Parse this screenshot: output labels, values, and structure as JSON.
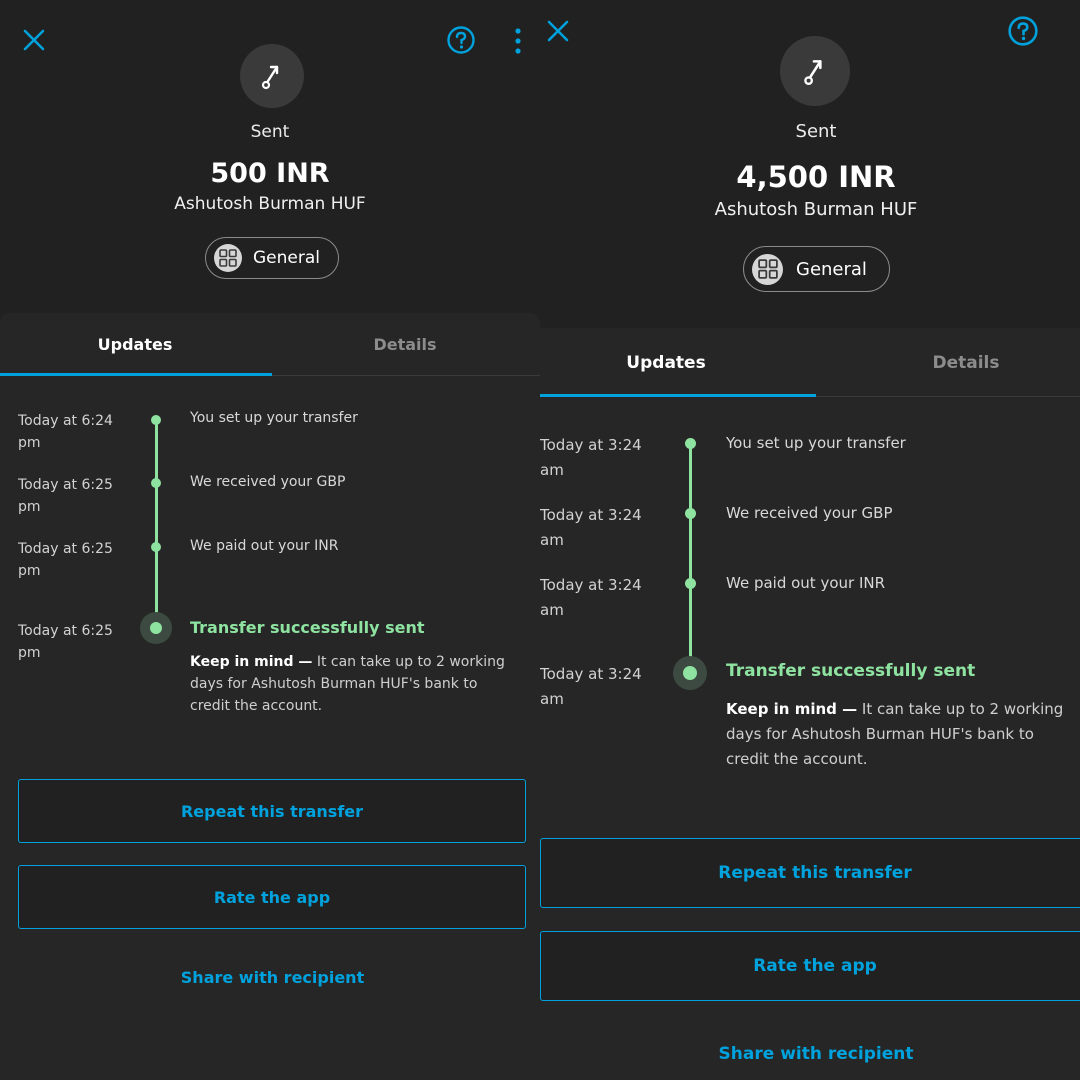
{
  "colors": {
    "background": "#212121",
    "panel": "#262626",
    "accent": "#00a2dd",
    "success": "#8ee3a1"
  },
  "icons": {
    "close": "close-icon",
    "help": "help-icon",
    "more": "more-vertical-icon",
    "sent": "sent-arrow-icon",
    "category": "category-grid-icon"
  },
  "screens": [
    {
      "status_label": "Sent",
      "amount": "500 INR",
      "recipient": "Ashutosh Burman HUF",
      "category": "General",
      "tabs": [
        {
          "label": "Updates",
          "active": true
        },
        {
          "label": "Details",
          "active": false
        }
      ],
      "timeline": [
        {
          "time": "Today at 6:24",
          "time_suffix": "pm",
          "text": "You set up your transfer"
        },
        {
          "time": "Today at 6:25",
          "time_suffix": "pm",
          "text": "We received your GBP"
        },
        {
          "time": "Today at 6:25",
          "time_suffix": "pm",
          "text": "We paid out your INR"
        },
        {
          "time": "Today at 6:25",
          "time_suffix": "pm",
          "text": "Transfer successfully sent"
        }
      ],
      "note": {
        "bold": "Keep in mind —",
        "line1": " It can take up to 2 working",
        "line2": "days for Ashutosh Burman HUF's bank to",
        "line3": "credit the account."
      },
      "actions": {
        "repeat": "Repeat this transfer",
        "rate": "Rate the app",
        "share": "Share with recipient"
      }
    },
    {
      "status_label": "Sent",
      "amount": "4,500 INR",
      "recipient": "Ashutosh Burman HUF",
      "category": "General",
      "tabs": [
        {
          "label": "Updates",
          "active": true
        },
        {
          "label": "Details",
          "active": false
        }
      ],
      "timeline": [
        {
          "time": "Today at 3:24",
          "time_suffix": "am",
          "text": "You set up your transfer"
        },
        {
          "time": "Today at 3:24",
          "time_suffix": "am",
          "text": "We received your GBP"
        },
        {
          "time": "Today at 3:24",
          "time_suffix": "am",
          "text": "We paid out your INR"
        },
        {
          "time": "Today at 3:24",
          "time_suffix": "am",
          "text": "Transfer successfully sent"
        }
      ],
      "note": {
        "bold": "Keep in mind —",
        "line1": " It can take up to 2 working",
        "line2": "days for Ashutosh Burman HUF's bank to",
        "line3": "credit the account."
      },
      "actions": {
        "repeat": "Repeat this transfer",
        "rate": "Rate the app",
        "share": "Share with recipient"
      }
    }
  ]
}
